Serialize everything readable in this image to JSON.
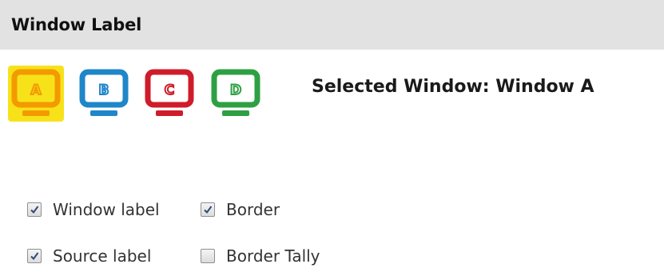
{
  "panel": {
    "title": "Window Label"
  },
  "windows": [
    {
      "letter": "A",
      "color": "#f39a00",
      "selected": true
    },
    {
      "letter": "B",
      "color": "#1f86c9",
      "selected": false
    },
    {
      "letter": "C",
      "color": "#cf1c2a",
      "selected": false
    },
    {
      "letter": "D",
      "color": "#2ea043",
      "selected": false
    }
  ],
  "selection": {
    "text": "Selected Window: Window A"
  },
  "options": {
    "window_label": {
      "label": "Window label",
      "checked": true
    },
    "border": {
      "label": "Border",
      "checked": true
    },
    "source_label": {
      "label": "Source label",
      "checked": true
    },
    "border_tally": {
      "label": "Border Tally",
      "checked": false
    }
  },
  "colors": {
    "selected_highlight": "#f7e21a",
    "header_background": "#e2e2e3"
  }
}
